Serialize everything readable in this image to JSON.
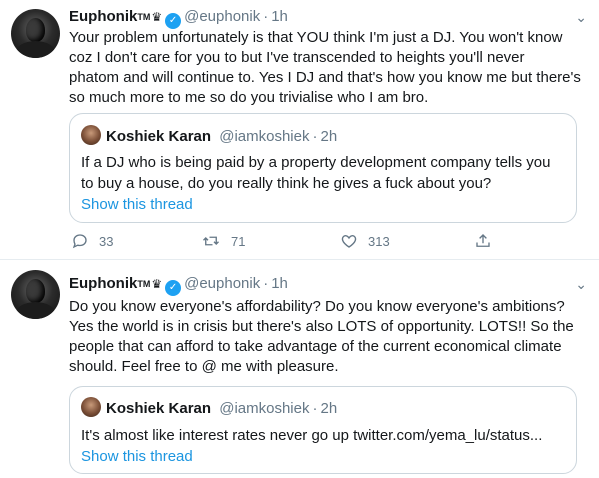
{
  "tweets": [
    {
      "author": {
        "name": "Euphonik",
        "tm": "TM",
        "crown": "♛",
        "handle": "@euphonik",
        "time": "1h"
      },
      "lines": [
        "Your problem unfortunately is that YOU think I'm just a DJ. You won't know",
        "coz I don't care for you to but I've transcended to heights you'll never",
        "phatom and will continue to. Yes I DJ and that's how you know me but there's",
        "so much more to me so do you trivialise who I am bro."
      ],
      "quote": {
        "name": "Koshiek Karan",
        "handle": "@iamkoshiek",
        "time": "2h",
        "lines": [
          "If a DJ who is being paid by a property development company tells you",
          "to buy a house, do you really think he gives a fuck about you?"
        ],
        "show_thread": "Show this thread"
      },
      "actions": {
        "replies": "33",
        "retweets": "71",
        "likes": "313"
      }
    },
    {
      "author": {
        "name": "Euphonik",
        "tm": "TM",
        "crown": "♛",
        "handle": "@euphonik",
        "time": "1h"
      },
      "lines": [
        "Do you know everyone's affordability? Do you know everyone's ambitions?",
        "Yes the world is in crisis but there's also LOTS of opportunity. LOTS!! So the",
        "people that can afford to take advantage of the current economical climate",
        "should. Feel free to @ me with pleasure."
      ],
      "quote": {
        "name": "Koshiek Karan",
        "handle": "@iamkoshiek",
        "time": "2h",
        "lines": [
          "It's almost like interest rates never go up twitter.com/yema_lu/status..."
        ],
        "show_thread": "Show this thread"
      }
    }
  ],
  "colors": {
    "accent": "#1da1f2",
    "link": "#1b95e0",
    "muted": "#657786",
    "border": "#ccd6dd"
  },
  "icons": {
    "verified": "verified-badge-icon",
    "chevron": "chevron-down-icon",
    "reply": "reply-icon",
    "retweet": "retweet-icon",
    "like": "heart-icon",
    "share": "share-icon"
  }
}
